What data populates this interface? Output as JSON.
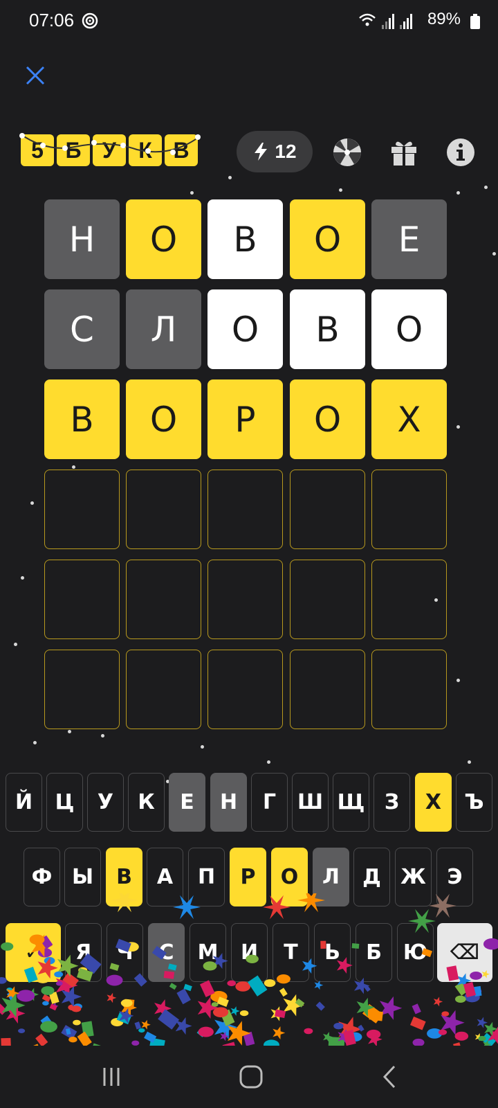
{
  "status_bar": {
    "time": "07:06",
    "battery": "89%"
  },
  "header": {
    "logo_letters": [
      "5",
      "Б",
      "У",
      "К",
      "В"
    ],
    "hints_count": "12",
    "icons": [
      "close-icon",
      "lightning-icon",
      "wheel-icon",
      "gift-icon",
      "info-icon"
    ]
  },
  "board": {
    "rows": [
      [
        {
          "letter": "Н",
          "state": "gray"
        },
        {
          "letter": "О",
          "state": "yellow"
        },
        {
          "letter": "В",
          "state": "white"
        },
        {
          "letter": "О",
          "state": "yellow"
        },
        {
          "letter": "Е",
          "state": "gray"
        }
      ],
      [
        {
          "letter": "С",
          "state": "gray"
        },
        {
          "letter": "Л",
          "state": "gray"
        },
        {
          "letter": "О",
          "state": "white"
        },
        {
          "letter": "В",
          "state": "white"
        },
        {
          "letter": "О",
          "state": "white"
        }
      ],
      [
        {
          "letter": "В",
          "state": "yellow"
        },
        {
          "letter": "О",
          "state": "yellow"
        },
        {
          "letter": "Р",
          "state": "yellow"
        },
        {
          "letter": "О",
          "state": "yellow"
        },
        {
          "letter": "Х",
          "state": "yellow"
        }
      ],
      [
        {
          "letter": "",
          "state": "empty"
        },
        {
          "letter": "",
          "state": "empty"
        },
        {
          "letter": "",
          "state": "empty"
        },
        {
          "letter": "",
          "state": "empty"
        },
        {
          "letter": "",
          "state": "empty"
        }
      ],
      [
        {
          "letter": "",
          "state": "empty"
        },
        {
          "letter": "",
          "state": "empty"
        },
        {
          "letter": "",
          "state": "empty"
        },
        {
          "letter": "",
          "state": "empty"
        },
        {
          "letter": "",
          "state": "empty"
        }
      ],
      [
        {
          "letter": "",
          "state": "empty"
        },
        {
          "letter": "",
          "state": "empty"
        },
        {
          "letter": "",
          "state": "empty"
        },
        {
          "letter": "",
          "state": "empty"
        },
        {
          "letter": "",
          "state": "empty"
        }
      ]
    ]
  },
  "keyboard": {
    "rows": [
      [
        {
          "label": "Й",
          "state": "default"
        },
        {
          "label": "Ц",
          "state": "default"
        },
        {
          "label": "У",
          "state": "default"
        },
        {
          "label": "К",
          "state": "default"
        },
        {
          "label": "Е",
          "state": "gray"
        },
        {
          "label": "Н",
          "state": "gray"
        },
        {
          "label": "Г",
          "state": "default"
        },
        {
          "label": "Ш",
          "state": "default"
        },
        {
          "label": "Щ",
          "state": "default"
        },
        {
          "label": "З",
          "state": "default"
        },
        {
          "label": "Х",
          "state": "yellow"
        },
        {
          "label": "Ъ",
          "state": "default"
        }
      ],
      [
        {
          "label": "Ф",
          "state": "default"
        },
        {
          "label": "Ы",
          "state": "default"
        },
        {
          "label": "В",
          "state": "yellow"
        },
        {
          "label": "А",
          "state": "default"
        },
        {
          "label": "П",
          "state": "default"
        },
        {
          "label": "Р",
          "state": "yellow"
        },
        {
          "label": "О",
          "state": "yellow"
        },
        {
          "label": "Л",
          "state": "gray"
        },
        {
          "label": "Д",
          "state": "default"
        },
        {
          "label": "Ж",
          "state": "default"
        },
        {
          "label": "Э",
          "state": "default"
        }
      ],
      [
        {
          "label": "✓",
          "state": "yellow",
          "kind": "enter"
        },
        {
          "label": "Я",
          "state": "default"
        },
        {
          "label": "Ч",
          "state": "default"
        },
        {
          "label": "С",
          "state": "gray"
        },
        {
          "label": "М",
          "state": "default"
        },
        {
          "label": "И",
          "state": "default"
        },
        {
          "label": "Т",
          "state": "default"
        },
        {
          "label": "Ь",
          "state": "default"
        },
        {
          "label": "Б",
          "state": "default"
        },
        {
          "label": "Ю",
          "state": "default"
        },
        {
          "label": "⌫",
          "state": "light",
          "kind": "backspace"
        }
      ]
    ]
  }
}
